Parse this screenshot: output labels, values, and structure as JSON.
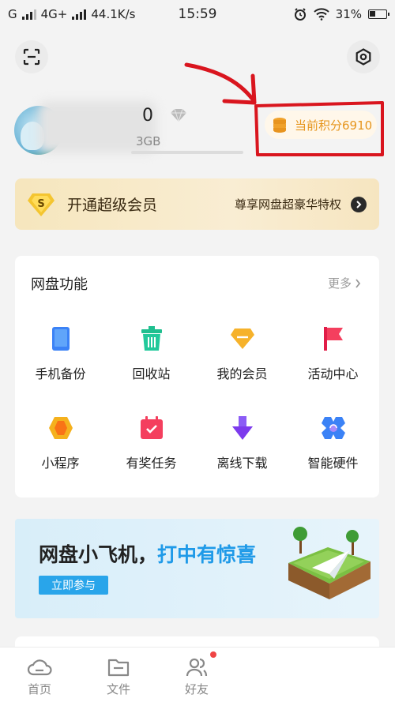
{
  "status_bar": {
    "carrier1": "G",
    "carrier2": "4G+",
    "speed": "44.1K/s",
    "time": "15:59",
    "battery": "31%"
  },
  "profile": {
    "name_visible_tail": "0",
    "storage_visible_tail": "3GB"
  },
  "points": {
    "label": "当前积分6910"
  },
  "vip": {
    "badge_letter": "S",
    "title": "开通超级会员",
    "subtitle": "尊享网盘超豪华特权"
  },
  "features": {
    "title": "网盘功能",
    "more": "更多",
    "items": [
      {
        "label": "手机备份",
        "icon": "phone-backup-icon"
      },
      {
        "label": "回收站",
        "icon": "recycle-bin-icon"
      },
      {
        "label": "我的会员",
        "icon": "membership-icon"
      },
      {
        "label": "活动中心",
        "icon": "activity-flag-icon"
      },
      {
        "label": "小程序",
        "icon": "mini-program-icon"
      },
      {
        "label": "有奖任务",
        "icon": "reward-task-icon"
      },
      {
        "label": "离线下载",
        "icon": "offline-download-icon"
      },
      {
        "label": "智能硬件",
        "icon": "smart-hardware-icon"
      }
    ]
  },
  "promo": {
    "title_part1": "网盘小飞机，",
    "title_part2": "打中有惊喜",
    "button": "立即参与"
  },
  "tabs": [
    {
      "label": "首页",
      "icon": "home-cloud-icon"
    },
    {
      "label": "文件",
      "icon": "folder-icon"
    },
    {
      "label": "好友",
      "icon": "friends-icon"
    }
  ],
  "colors": {
    "accent": "#1f9ae8",
    "points": "#e6951c",
    "annotation": "#d9151e"
  }
}
